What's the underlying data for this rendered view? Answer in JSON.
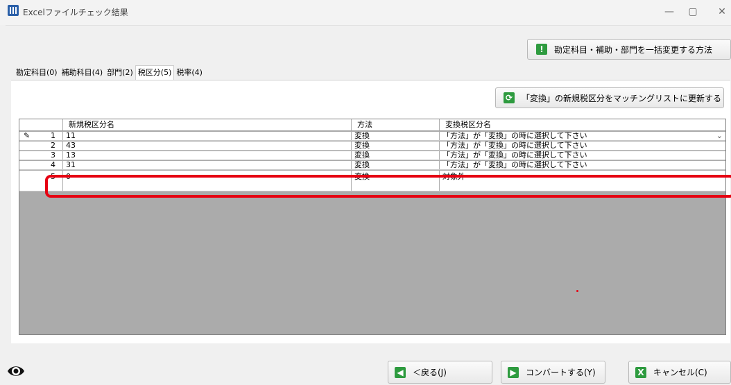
{
  "window": {
    "title": "Excelファイルチェック結果",
    "minimize": "—",
    "maximize": "▢",
    "close": "✕"
  },
  "top_button": {
    "label": "勘定科目・補助・部門を一括変更する方法"
  },
  "update_button": {
    "label": "「変換」の新規税区分をマッチングリストに更新する"
  },
  "tabs": [
    {
      "label": "勘定科目(0)"
    },
    {
      "label": "補助科目(4)"
    },
    {
      "label": "部門(2)"
    },
    {
      "label": "税区分(5)"
    },
    {
      "label": "税率(4)"
    }
  ],
  "grid": {
    "headers": [
      "新規税区分名",
      "方法",
      "変換税区分名"
    ],
    "rows": [
      {
        "num": "1",
        "marker": "✎",
        "name": "11",
        "method": "変換",
        "target": "「方法」が「変換」の時に選択して下さい"
      },
      {
        "num": "2",
        "marker": "",
        "name": "43",
        "method": "変換",
        "target": "「方法」が「変換」の時に選択して下さい"
      },
      {
        "num": "3",
        "marker": "",
        "name": "13",
        "method": "変換",
        "target": "「方法」が「変換」の時に選択して下さい"
      },
      {
        "num": "4",
        "marker": "",
        "name": "31",
        "method": "変換",
        "target": "「方法」が「変換」の時に選択して下さい"
      },
      {
        "num": "5",
        "marker": "",
        "name": "0",
        "method": "変換",
        "target": "対象外"
      }
    ]
  },
  "footer": {
    "back": "＜戻る(J)",
    "convert": "コンバートする(Y)",
    "cancel": "キャンセル(C)"
  },
  "colors": {
    "highlight": "#e60012",
    "grid_bg": "#ababab",
    "accent_green": "#2e9b3f"
  }
}
